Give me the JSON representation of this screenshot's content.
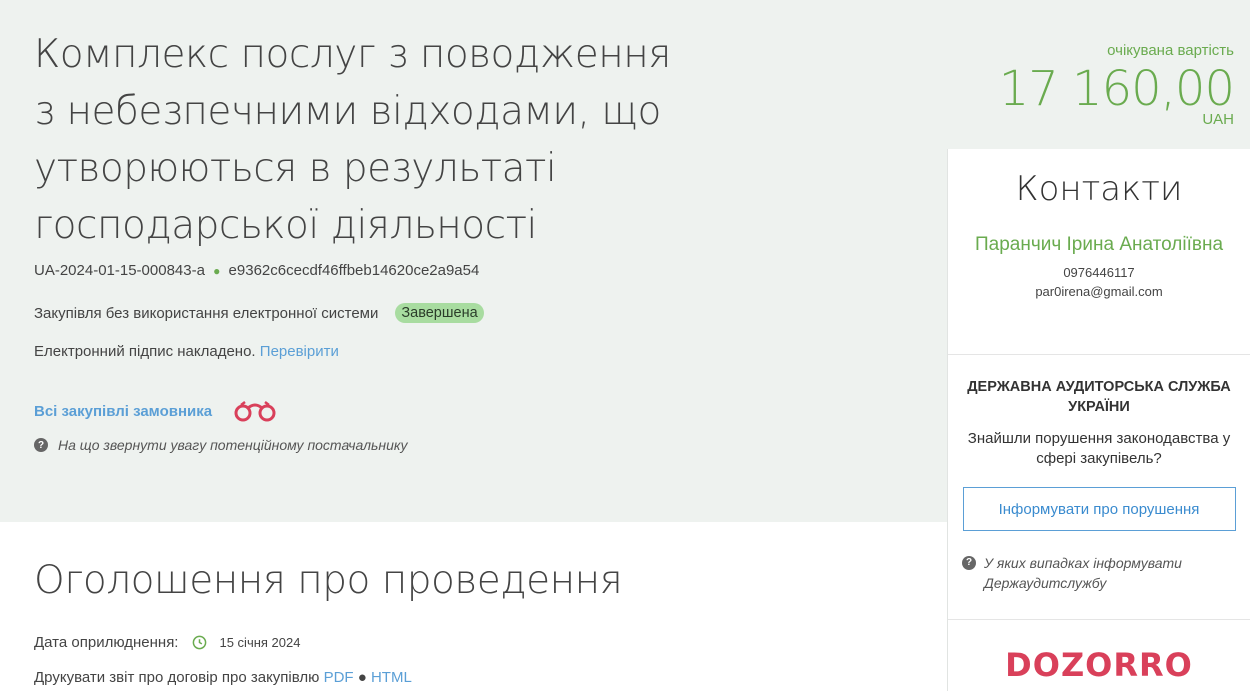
{
  "tender": {
    "title": "Комплекс послуг з поводження з небезпечними відходами, що утворюються в результаті господарської діяльності",
    "id": "UA-2024-01-15-000843-a",
    "hash": "e9362c6cecdf46ffbeb14620ce2a9a54",
    "procedure_type": "Закупівля без використання електронної системи",
    "status": "Завершена",
    "signature_text": "Електронний підпис накладено.",
    "verify_link": "Перевірити",
    "all_purchases_link": "Всі закупівлі замовника",
    "supplier_hint": "На що звернути увагу потенційному постачальнику"
  },
  "price": {
    "label": "очікувана вартість",
    "value": "17 160,00",
    "currency": "UAH"
  },
  "contacts": {
    "title": "Контакти",
    "name": "Паранчич Ірина Анатоліївна",
    "phone": "0976446117",
    "email": "par0irena@gmail.com"
  },
  "audit": {
    "title": "ДЕРЖАВНА АУДИТОРСЬКА СЛУЖБА УКРАЇНИ",
    "question": "Знайшли порушення законодавства у сфері закупівель?",
    "button": "Інформувати про порушення",
    "hint": "У яких випадках інформувати Держаудитслужбу"
  },
  "dozorro": {
    "logo_text": "DOZORRO",
    "color": "#d9405a"
  },
  "announcement": {
    "title": "Оголошення про проведення",
    "pub_date_label": "Дата оприлюднення:",
    "pub_date": "15 січня 2024",
    "print_text": "Друкувати звіт про договір про закупівлю",
    "pdf": "PDF",
    "html": "HTML"
  },
  "colors": {
    "accent_green": "#6aab4f",
    "link_blue": "#5b9fd6",
    "hero_bg": "#eef2ef",
    "badge_bg": "#a8dca0"
  }
}
